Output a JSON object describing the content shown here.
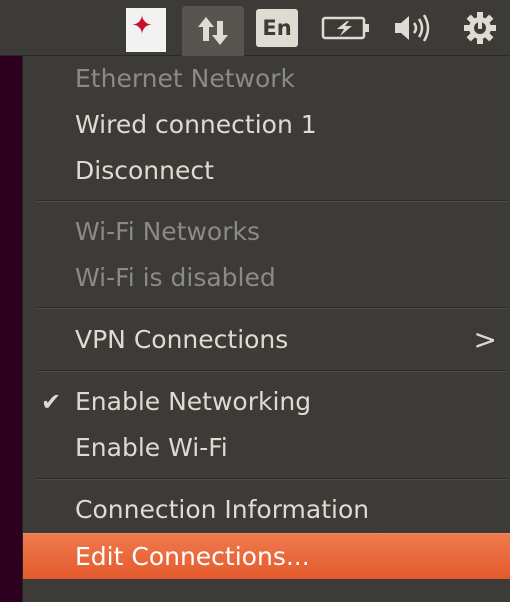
{
  "panel": {
    "app_indicator_mark": "✦",
    "keyboard_layout": "En",
    "icons": [
      "app-indicator-icon",
      "network-transfer-icon",
      "keyboard-layout-icon",
      "battery-charging-icon",
      "volume-icon",
      "power-gear-icon"
    ]
  },
  "menu": {
    "ethernet_header": "Ethernet Network",
    "wired_connection": "Wired connection 1",
    "disconnect": "Disconnect",
    "wifi_header": "Wi-Fi Networks",
    "wifi_status": "Wi-Fi is disabled",
    "vpn": "VPN Connections",
    "vpn_arrow": ">",
    "enable_networking": "Enable Networking",
    "enable_networking_check": "✔",
    "enable_wifi": "Enable Wi-Fi",
    "connection_info": "Connection Information",
    "edit_connections": "Edit Connections..."
  },
  "colors": {
    "panel_bg": "#3c3b37",
    "menu_text": "#dfdbd2",
    "disabled_text": "#8c8a85",
    "highlight": "#e9673a",
    "desktop": "#2c001e"
  }
}
